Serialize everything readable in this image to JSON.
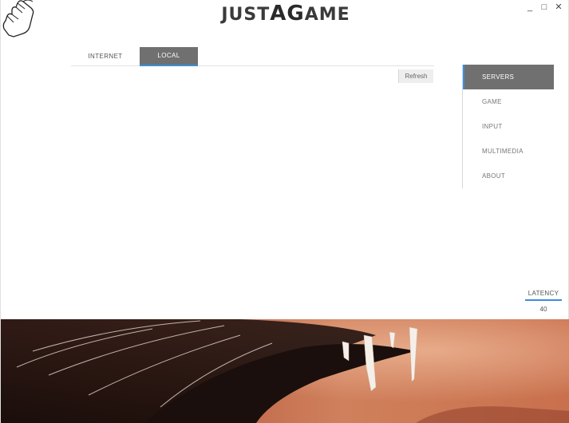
{
  "app": {
    "logo_text_1": "JUST",
    "logo_text_2": "A",
    "logo_text_3": "G",
    "logo_text_4": "AME"
  },
  "window_controls": {
    "minimize": "_",
    "maximize": "□",
    "close": "✕"
  },
  "tabs": [
    {
      "label": "INTERNET",
      "active": false
    },
    {
      "label": "LOCAL",
      "active": true
    }
  ],
  "toolbar": {
    "refresh_label": "Refresh"
  },
  "sidebar": {
    "items": [
      {
        "label": "SERVERS",
        "active": true
      },
      {
        "label": "GAME",
        "active": false
      },
      {
        "label": "INPUT",
        "active": false
      },
      {
        "label": "MULTIMEDIA",
        "active": false
      },
      {
        "label": "ABOUT",
        "active": false
      }
    ]
  },
  "latency": {
    "label": "LATENCY",
    "value": "40"
  },
  "colors": {
    "accent": "#3a8fd9",
    "active_bg": "#707070"
  },
  "icons": {
    "cursor": "hand-pointer-icon"
  }
}
